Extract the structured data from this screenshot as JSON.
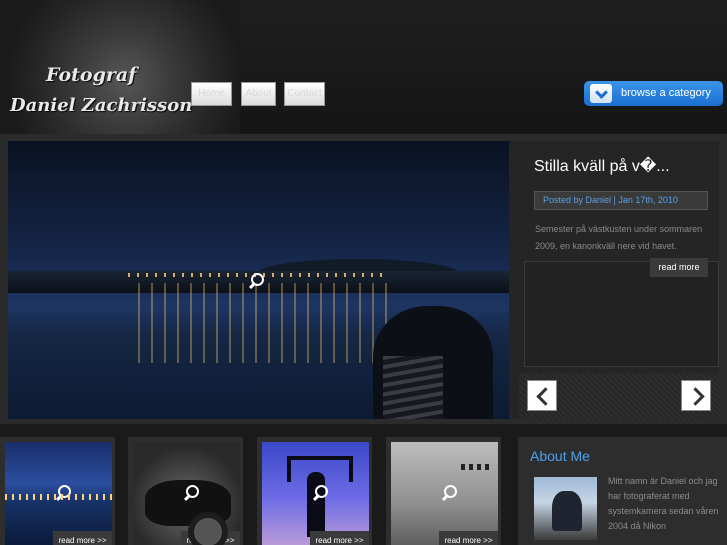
{
  "header": {
    "logo_line1": "Fotograf",
    "logo_line2": "Daniel Zachrisson",
    "nav": [
      {
        "label": "Home"
      },
      {
        "label": "About"
      },
      {
        "label": "Contact"
      }
    ],
    "browse_label": "browse a category",
    "accent_color": "#2a84e0"
  },
  "featured": {
    "title": "Stilla kväll på v�...",
    "meta": "Posted by Daniel | Jan 17th, 2010",
    "excerpt": "Semester på västkusten under sommaren 2009, en kanonkväll nere vid havet.",
    "read_more": "read more",
    "prev_icon": "chevron-left-icon",
    "next_icon": "chevron-right-icon"
  },
  "thumbnails": [
    {
      "read_more": "read more >>"
    },
    {
      "read_more": "read more >>"
    },
    {
      "read_more": "read more >>"
    },
    {
      "read_more": "read more >>"
    }
  ],
  "about": {
    "title": "About Me",
    "text": "Mitt namn är Daniel och jag har fotograferat med systemkamera sedan våren 2004 då Nikon"
  }
}
